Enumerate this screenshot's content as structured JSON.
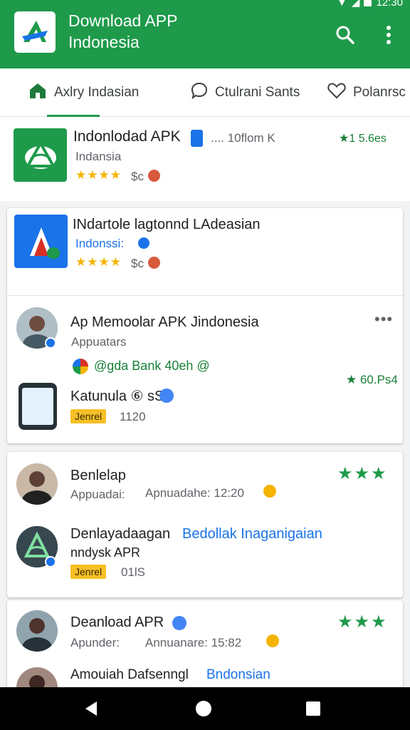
{
  "status": {
    "time": "12:30"
  },
  "header": {
    "title": "Download APP Indonesia"
  },
  "tabs": [
    {
      "label": "Axlry Indasian"
    },
    {
      "label": "Ctulrani Sants"
    },
    {
      "label": "Polanrsc"
    }
  ],
  "apps": [
    {
      "name": "Indonlodad APK",
      "extra": ".... 10flom K",
      "subtitle": "Indansia",
      "stars": "★★★★",
      "price": "$c",
      "rating": "★1 5.6es"
    },
    {
      "name": "INdartole lagtonnd LAdeasian",
      "subtitle": "Indonssi:",
      "stars": "★★★★",
      "price": "$c"
    }
  ],
  "feed": [
    {
      "title": "Ap Memoolar APK Jindonesia",
      "subtitle": "Appuatars",
      "menu": "•••",
      "line": "@gda Bank 40eh @",
      "rating": "★ 60.Ps4",
      "sub_name": "Katunula ⑥ sS",
      "badge": "Jenrel",
      "sub_meta": "1120"
    },
    {
      "title": "Benlelap",
      "subtitle": "Appuadai:",
      "meta": "Apnuadahe: 12:20",
      "stars": "★★★",
      "sub_name": "Denlayadaagan",
      "sub_link": "Bedollak Inaganigaian",
      "sub_line2": "nndysk APR",
      "badge": "Jenrel",
      "sub_meta": "01lS"
    },
    {
      "title": "Deanload APR",
      "subtitle": "Apunder:",
      "meta": "Annuanare: 15:82",
      "stars": "★★★",
      "sub_name": "Amouiah Dafsenngl",
      "sub_link": "Bndonsian"
    }
  ],
  "colors": {
    "brand": "#1e9a4a",
    "link": "#1a73e8",
    "badge": "#f6c026"
  },
  "icons": [
    "search-icon",
    "more-vert-icon",
    "home-icon",
    "chat-icon",
    "heart-icon",
    "back-icon",
    "home-nav-icon",
    "recents-icon"
  ]
}
